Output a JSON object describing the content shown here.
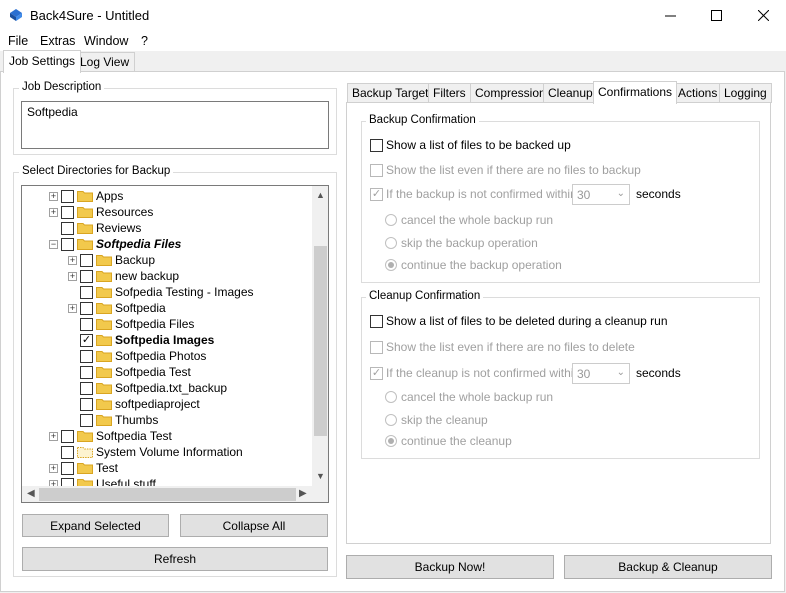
{
  "window": {
    "title": "Back4Sure - Untitled",
    "minimize_icon": "minimize-icon",
    "maximize_icon": "maximize-icon",
    "close_icon": "close-icon"
  },
  "menu": {
    "file": "File",
    "extras": "Extras",
    "window": "Window",
    "help": "?"
  },
  "outer_tabs": {
    "job_settings": "Job Settings",
    "log_view": "Log View"
  },
  "job_description": {
    "label": "Job Description",
    "value": "Softpedia"
  },
  "directories": {
    "label": "Select Directories for Backup",
    "items": [
      {
        "label": "Apps"
      },
      {
        "label": "Resources"
      },
      {
        "label": "Reviews"
      },
      {
        "label": "Softpedia Files"
      },
      {
        "label": "Backup"
      },
      {
        "label": "new backup"
      },
      {
        "label": "Sofpedia Testing - Images"
      },
      {
        "label": "Softpedia"
      },
      {
        "label": "Softpedia Files"
      },
      {
        "label": "Softpedia Images"
      },
      {
        "label": "Softpedia Photos"
      },
      {
        "label": "Softpedia Test"
      },
      {
        "label": "Softpedia.txt_backup"
      },
      {
        "label": "softpediaproject"
      },
      {
        "label": "Thumbs"
      },
      {
        "label": "Softpedia Test"
      },
      {
        "label": "System Volume Information"
      },
      {
        "label": "Test"
      },
      {
        "label": "Useful stuff"
      }
    ]
  },
  "buttons": {
    "expand_selected": "Expand Selected",
    "collapse_all": "Collapse All",
    "refresh": "Refresh",
    "backup_now": "Backup Now!",
    "backup_cleanup": "Backup & Cleanup"
  },
  "inner_tabs": {
    "backup_target": "Backup Target",
    "filters": "Filters",
    "compression": "Compression",
    "cleanup": "Cleanup",
    "confirmations": "Confirmations",
    "actions": "Actions",
    "logging": "Logging"
  },
  "backup_confirmation": {
    "label": "Backup Confirmation",
    "show_list": "Show a list of files to be backed up",
    "show_even_if_none": "Show the list even if there are no files to backup",
    "if_not_confirmed": "If the backup is not confirmed within",
    "seconds_value": "30",
    "seconds_label": "seconds",
    "cancel": "cancel the whole backup run",
    "skip": "skip the backup operation",
    "continue": "continue the backup operation"
  },
  "cleanup_confirmation": {
    "label": "Cleanup Confirmation",
    "show_list": "Show a list of files to be deleted during a cleanup run",
    "show_even_if_none": "Show the list even if there are no files to delete",
    "if_not_confirmed": "If the cleanup is not confirmed within",
    "seconds_value": "30",
    "seconds_label": "seconds",
    "cancel": "cancel the whole backup run",
    "skip": "skip the cleanup",
    "continue": "continue the cleanup"
  },
  "colors": {
    "folder": "#f2c94c",
    "folder_dark": "#d9a521",
    "accent": "#0078d7"
  }
}
